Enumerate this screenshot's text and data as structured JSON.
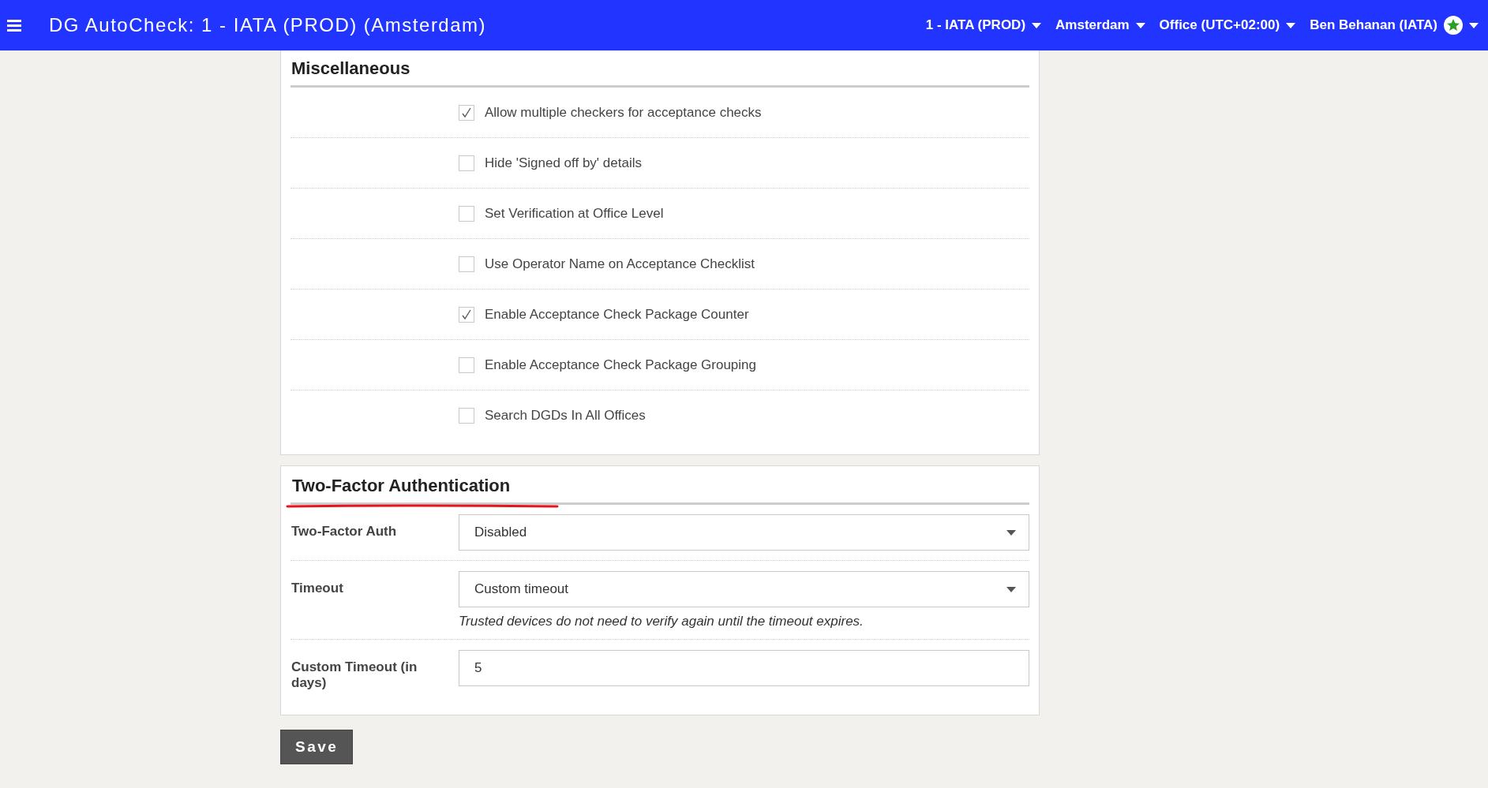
{
  "header": {
    "title": "DG AutoCheck: 1 - IATA (PROD) (Amsterdam)",
    "menus": [
      {
        "label": "1 - IATA (PROD)",
        "kind": "text"
      },
      {
        "label": "Amsterdam",
        "kind": "text"
      },
      {
        "label": "Office (UTC+02:00)",
        "kind": "text"
      },
      {
        "label": "Ben Behanan (IATA)",
        "kind": "user"
      }
    ]
  },
  "miscellaneous": {
    "title": "Miscellaneous",
    "options": [
      {
        "label": "Allow multiple checkers for acceptance checks",
        "checked": true
      },
      {
        "label": "Hide 'Signed off by' details",
        "checked": false
      },
      {
        "label": "Set Verification at Office Level",
        "checked": false
      },
      {
        "label": "Use Operator Name on Acceptance Checklist",
        "checked": false
      },
      {
        "label": "Enable Acceptance Check Package Counter",
        "checked": true
      },
      {
        "label": "Enable Acceptance Check Package Grouping",
        "checked": false
      },
      {
        "label": "Search DGDs In All Offices",
        "checked": false
      }
    ]
  },
  "two_factor": {
    "title": "Two-Factor Authentication",
    "annotated": true,
    "fields": [
      {
        "kind": "select",
        "label": "Two-Factor Auth",
        "value": "Disabled"
      },
      {
        "kind": "select",
        "label": "Timeout",
        "value": "Custom timeout",
        "help": "Trusted devices do not need to verify again until the timeout expires."
      },
      {
        "kind": "input",
        "label": "Custom Timeout (in days)",
        "value": "5"
      }
    ]
  },
  "save_button": "Save"
}
